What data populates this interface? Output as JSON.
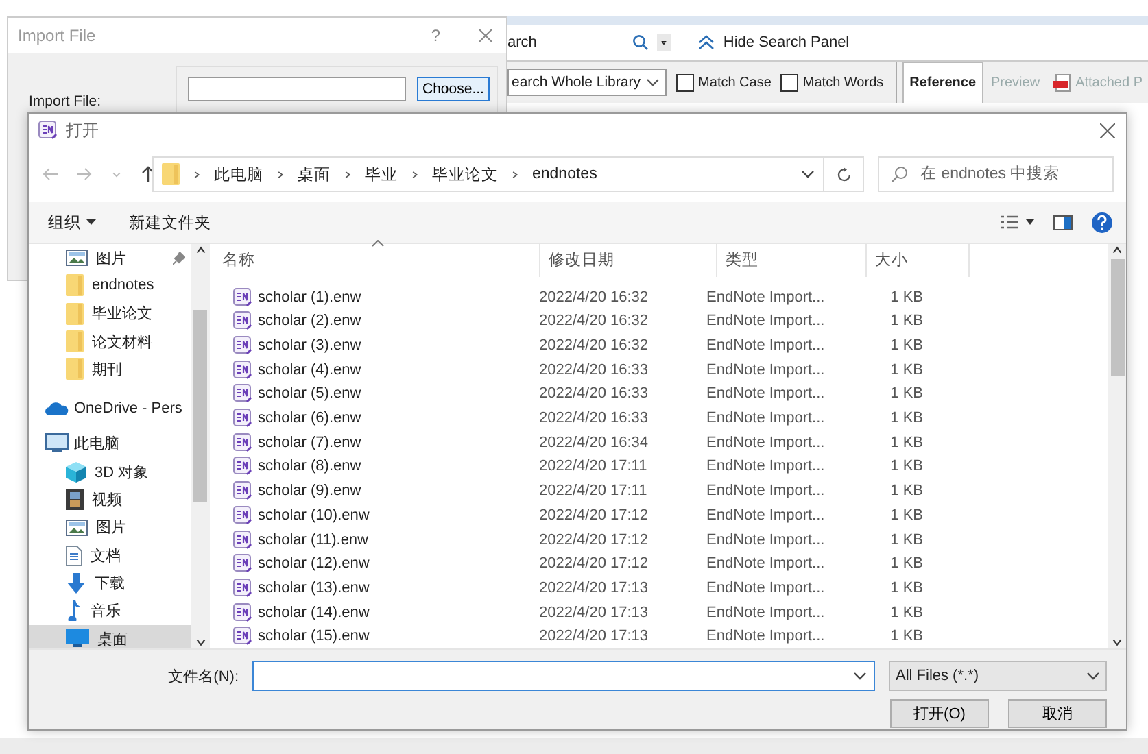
{
  "background_app": {
    "search_label": "arch",
    "hide_search_panel": "Hide Search Panel",
    "scope": "earch Whole Library",
    "options": [
      {
        "label": "Match Case",
        "checked": false
      },
      {
        "label": "Match Words",
        "checked": false
      }
    ],
    "tabs": [
      {
        "label": "Reference",
        "selected": true,
        "kind": "text"
      },
      {
        "label": "Preview",
        "selected": false,
        "kind": "text"
      },
      {
        "label": "Attached P",
        "selected": false,
        "kind": "pdf"
      }
    ]
  },
  "import_dialog": {
    "title": "Import File",
    "help": "?",
    "field_label": "Import File:",
    "choose_button": "Choose..."
  },
  "open_dialog": {
    "title": "打开",
    "breadcrumb": [
      "此电脑",
      "桌面",
      "毕业",
      "毕业论文",
      "endnotes"
    ],
    "search": {
      "placeholder": "在 endnotes 中搜索"
    },
    "organize": "组织",
    "new_folder": "新建文件夹",
    "quick_access": [
      {
        "label": "图片",
        "kind": "pictures",
        "pinned": true,
        "selected": false
      },
      {
        "label": "endnotes",
        "kind": "folder",
        "pinned": false,
        "selected": false
      },
      {
        "label": "毕业论文",
        "kind": "folder",
        "pinned": false,
        "selected": false
      },
      {
        "label": "论文材料",
        "kind": "folder",
        "pinned": false,
        "selected": false
      },
      {
        "label": "期刊",
        "kind": "folder",
        "pinned": false,
        "selected": false
      }
    ],
    "nav": [
      {
        "label": "OneDrive - Pers",
        "kind": "cloud",
        "selected": false
      },
      {
        "label": "此电脑",
        "kind": "computer",
        "selected": false,
        "children": [
          {
            "label": "3D 对象",
            "kind": "cube",
            "selected": false
          },
          {
            "label": "视频",
            "kind": "video",
            "selected": false
          },
          {
            "label": "图片",
            "kind": "pictures",
            "selected": false
          },
          {
            "label": "文档",
            "kind": "document",
            "selected": false
          },
          {
            "label": "下载",
            "kind": "download",
            "selected": false
          },
          {
            "label": "音乐",
            "kind": "music",
            "selected": false
          },
          {
            "label": "桌面",
            "kind": "desktop",
            "selected": true
          }
        ]
      }
    ],
    "columns": [
      "名称",
      "修改日期",
      "类型",
      "大小"
    ],
    "files": [
      {
        "name": "scholar (1).enw",
        "modified": "2022/4/20 16:32",
        "type": "EndNote Import...",
        "size": "1 KB"
      },
      {
        "name": "scholar (2).enw",
        "modified": "2022/4/20 16:32",
        "type": "EndNote Import...",
        "size": "1 KB"
      },
      {
        "name": "scholar (3).enw",
        "modified": "2022/4/20 16:32",
        "type": "EndNote Import...",
        "size": "1 KB"
      },
      {
        "name": "scholar (4).enw",
        "modified": "2022/4/20 16:33",
        "type": "EndNote Import...",
        "size": "1 KB"
      },
      {
        "name": "scholar (5).enw",
        "modified": "2022/4/20 16:33",
        "type": "EndNote Import...",
        "size": "1 KB"
      },
      {
        "name": "scholar (6).enw",
        "modified": "2022/4/20 16:33",
        "type": "EndNote Import...",
        "size": "1 KB"
      },
      {
        "name": "scholar (7).enw",
        "modified": "2022/4/20 16:34",
        "type": "EndNote Import...",
        "size": "1 KB"
      },
      {
        "name": "scholar (8).enw",
        "modified": "2022/4/20 17:11",
        "type": "EndNote Import...",
        "size": "1 KB"
      },
      {
        "name": "scholar (9).enw",
        "modified": "2022/4/20 17:11",
        "type": "EndNote Import...",
        "size": "1 KB"
      },
      {
        "name": "scholar (10).enw",
        "modified": "2022/4/20 17:12",
        "type": "EndNote Import...",
        "size": "1 KB"
      },
      {
        "name": "scholar (11).enw",
        "modified": "2022/4/20 17:12",
        "type": "EndNote Import...",
        "size": "1 KB"
      },
      {
        "name": "scholar (12).enw",
        "modified": "2022/4/20 17:12",
        "type": "EndNote Import...",
        "size": "1 KB"
      },
      {
        "name": "scholar (13).enw",
        "modified": "2022/4/20 17:13",
        "type": "EndNote Import...",
        "size": "1 KB"
      },
      {
        "name": "scholar (14).enw",
        "modified": "2022/4/20 17:13",
        "type": "EndNote Import...",
        "size": "1 KB"
      },
      {
        "name": "scholar (15).enw",
        "modified": "2022/4/20 17:13",
        "type": "EndNote Import...",
        "size": "1 KB"
      }
    ],
    "filename_label": "文件名(N):",
    "filter": "All Files (*.*)",
    "buttons": [
      "打开(O)",
      "取消"
    ]
  }
}
